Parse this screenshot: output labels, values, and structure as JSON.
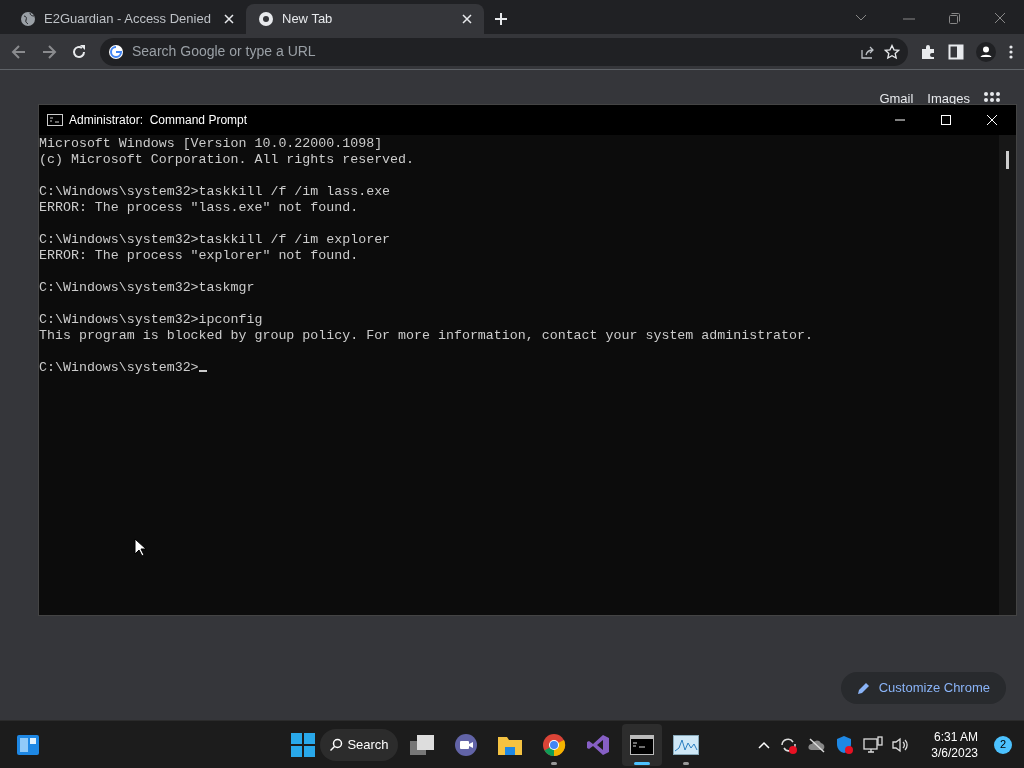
{
  "browser": {
    "tabs": [
      {
        "title": "E2Guardian - Access Denied",
        "selected": false,
        "kind": "globe"
      },
      {
        "title": "New Tab",
        "selected": true,
        "kind": "chrome"
      }
    ],
    "address_bar": {
      "placeholder": "Search Google or type a URL"
    },
    "ntp_links": [
      "Gmail",
      "Images"
    ],
    "customize_button": "Customize Chrome"
  },
  "console": {
    "title": "Administrator:  Command Prompt",
    "blocks": [
      [
        "Microsoft Windows [Version 10.0.22000.1098]",
        "(c) Microsoft Corporation. All rights reserved."
      ],
      [
        "C:\\Windows\\system32>taskkill /f /im lass.exe",
        "ERROR: The process \"lass.exe\" not found."
      ],
      [
        "C:\\Windows\\system32>taskkill /f /im explorer",
        "ERROR: The process \"explorer\" not found."
      ],
      [
        "C:\\Windows\\system32>taskmgr"
      ],
      [
        "C:\\Windows\\system32>ipconfig",
        "This program is blocked by group policy. For more information, contact your system administrator."
      ],
      [
        "C:\\Windows\\system32>"
      ]
    ]
  },
  "taskbar": {
    "search_label": "Search",
    "apps": [
      {
        "kind": "taskview",
        "running": false,
        "active": false
      },
      {
        "kind": "teams",
        "running": false,
        "active": false
      },
      {
        "kind": "explorer",
        "running": false,
        "active": false
      },
      {
        "kind": "chrome",
        "running": true,
        "active": false
      },
      {
        "kind": "vstudio",
        "running": false,
        "active": false
      },
      {
        "kind": "terminal",
        "running": true,
        "active": true
      },
      {
        "kind": "monitor",
        "running": true,
        "active": false
      }
    ],
    "time": "6:31 AM",
    "date": "3/6/2023",
    "notification_count": "2"
  }
}
